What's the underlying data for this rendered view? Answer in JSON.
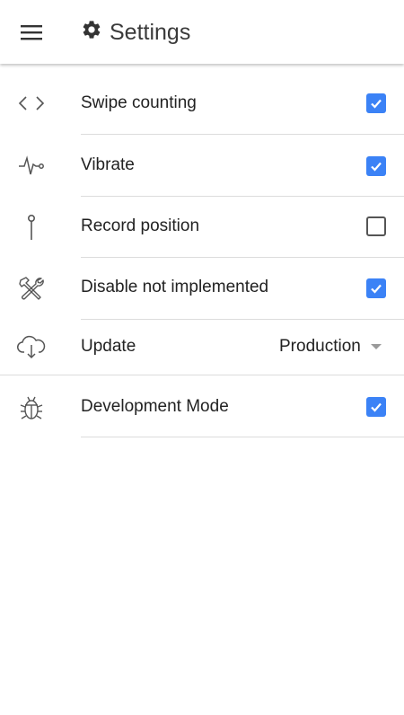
{
  "header": {
    "title": "Settings",
    "menu_icon": "hamburger-menu-icon",
    "title_icon": "gear-icon"
  },
  "settings": [
    {
      "icon": "code-brackets-icon",
      "label": "Swipe counting",
      "control": "checkbox",
      "checked": true
    },
    {
      "icon": "heartbeat-wave-icon",
      "label": "Vibrate",
      "control": "checkbox",
      "checked": true
    },
    {
      "icon": "pin-icon",
      "label": "Record position",
      "control": "checkbox",
      "checked": false
    },
    {
      "icon": "tools-icon",
      "label": "Disable not implemented",
      "control": "checkbox",
      "checked": true
    },
    {
      "icon": "cloud-download-icon",
      "label": "Update",
      "control": "select",
      "value": "Production"
    },
    {
      "icon": "bug-icon",
      "label": "Development Mode",
      "control": "checkbox",
      "checked": true
    }
  ],
  "colors": {
    "checkbox_checked": "#3b82f6",
    "divider": "#dcdcdc",
    "icon": "#555555"
  }
}
